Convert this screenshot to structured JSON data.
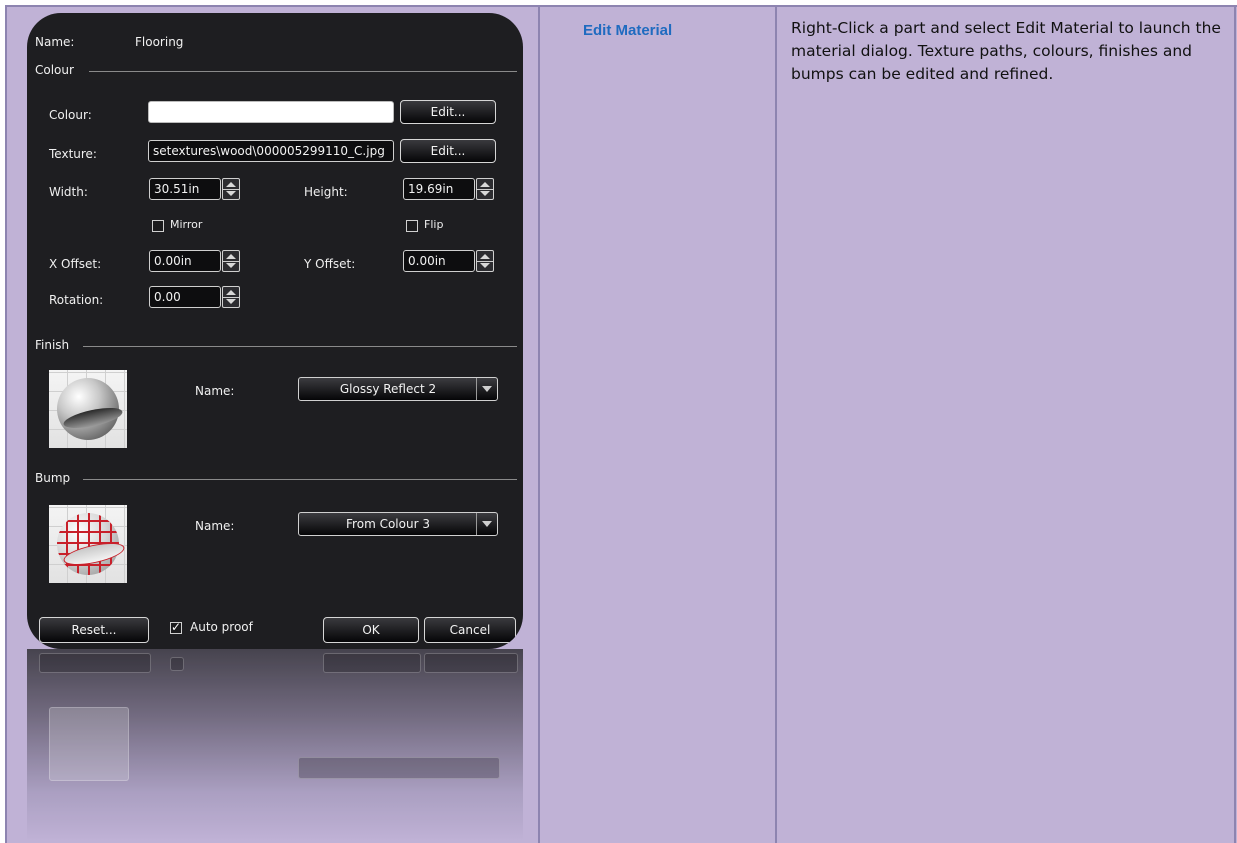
{
  "doc": {
    "title": "Edit Material",
    "description": "Right-Click a part and select Edit Material to launch the material dialog. Texture paths, colours, finishes and bumps can be edited and refined."
  },
  "dialog": {
    "name_label": "Name:",
    "name_value": "Flooring",
    "colour_section": "Colour",
    "colour_label": "Colour:",
    "colour_value": "",
    "edit_label": "Edit...",
    "texture_label": "Texture:",
    "texture_value": "setextures\\wood\\000005299110_C.jpg",
    "width_label": "Width:",
    "width_value": "30.51in",
    "height_label": "Height:",
    "height_value": "19.69in",
    "mirror_label": "Mirror",
    "flip_label": "Flip",
    "x_offset_label": "X Offset:",
    "x_offset_value": "0.00in",
    "y_offset_label": "Y Offset:",
    "y_offset_value": "0.00in",
    "rotation_label": "Rotation:",
    "rotation_value": "0.00",
    "finish_section": "Finish",
    "finish_name_label": "Name:",
    "finish_value": "Glossy Reflect 2",
    "bump_section": "Bump",
    "bump_name_label": "Name:",
    "bump_value": "From Colour 3",
    "reset_label": "Reset...",
    "auto_proof_label": "Auto proof",
    "ok_label": "OK",
    "cancel_label": "Cancel"
  },
  "colors": {
    "background": "#c0b2d6",
    "title": "#1f6bc0",
    "dialog": "#1e1e21"
  }
}
